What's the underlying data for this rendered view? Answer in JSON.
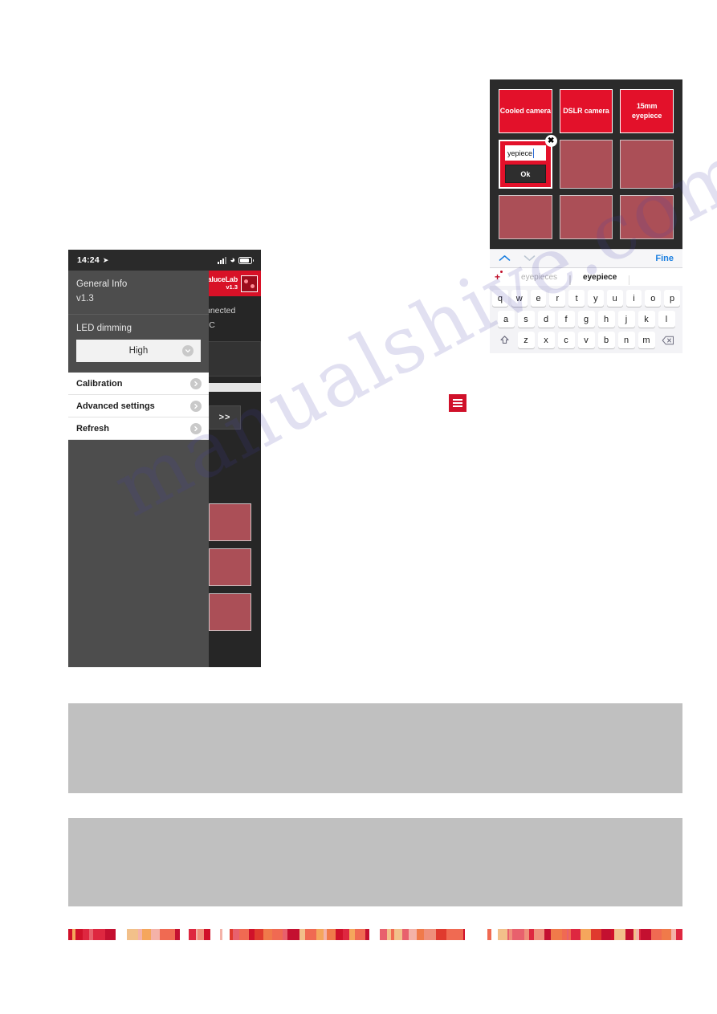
{
  "phone": {
    "statusbar": {
      "clock": "14:24",
      "location_icon": "location-arrow-icon",
      "signal_icon": "cellular-signal-icon",
      "wifi_icon": "wifi-icon",
      "battery_icon": "battery-icon"
    },
    "app_background": {
      "logo_name": "PrimaluceLab",
      "logo_version": "v1.3",
      "text_line_1": "nnected",
      "text_line_2": "°C",
      "next_button_label": ">>"
    },
    "menu": {
      "general_info_label": "General Info",
      "general_info_value": "v1.3",
      "led_dimming_label": "LED dimming",
      "led_dimming_value": "High",
      "rows": [
        {
          "label": "Calibration"
        },
        {
          "label": "Advanced settings"
        },
        {
          "label": "Refresh"
        }
      ]
    }
  },
  "tablet": {
    "tiles": [
      {
        "label": "Cooled camera",
        "state": "active"
      },
      {
        "label": "DSLR camera",
        "state": "active"
      },
      {
        "label": "15mm eyepiece",
        "state": "active"
      },
      {
        "label": "",
        "state": "editing"
      },
      {
        "label": "",
        "state": "idle"
      },
      {
        "label": "",
        "state": "idle"
      },
      {
        "label": "",
        "state": "idle"
      },
      {
        "label": "",
        "state": "idle"
      },
      {
        "label": "",
        "state": "idle"
      }
    ],
    "edit_popup": {
      "input_value": "yepiece",
      "ok_label": "Ok",
      "close_icon": "close-icon"
    },
    "accessory_bar": {
      "prev_icon": "chevron-up-icon",
      "next_icon": "chevron-down-icon",
      "done_label": "Fine"
    },
    "suggestions": {
      "add_icon": "plus-icon",
      "items": [
        {
          "text": "eyepieces",
          "style": "dim"
        },
        {
          "text": "eyepiece",
          "style": "bold"
        }
      ]
    },
    "keyboard": {
      "row1": [
        "q",
        "w",
        "e",
        "r",
        "t",
        "y",
        "u",
        "i",
        "o",
        "p"
      ],
      "row2": [
        "a",
        "s",
        "d",
        "f",
        "g",
        "h",
        "j",
        "k",
        "l"
      ],
      "row3": [
        "z",
        "x",
        "c",
        "v",
        "b",
        "n",
        "m"
      ],
      "shift_icon": "shift-icon",
      "backspace_icon": "backspace-icon"
    }
  },
  "hamburger_button": {
    "icon": "hamburger-menu-icon"
  },
  "watermark": {
    "text": "manualshive.com"
  },
  "colors": {
    "brand_red": "#d0112a",
    "tile_active": "#e3112a",
    "tile_idle": "#ab4f57",
    "menu_gray": "#4d4d4d",
    "app_dark": "#262626",
    "accent_blue": "#1b7fe0",
    "placeholder_gray": "#c0c0c0"
  }
}
